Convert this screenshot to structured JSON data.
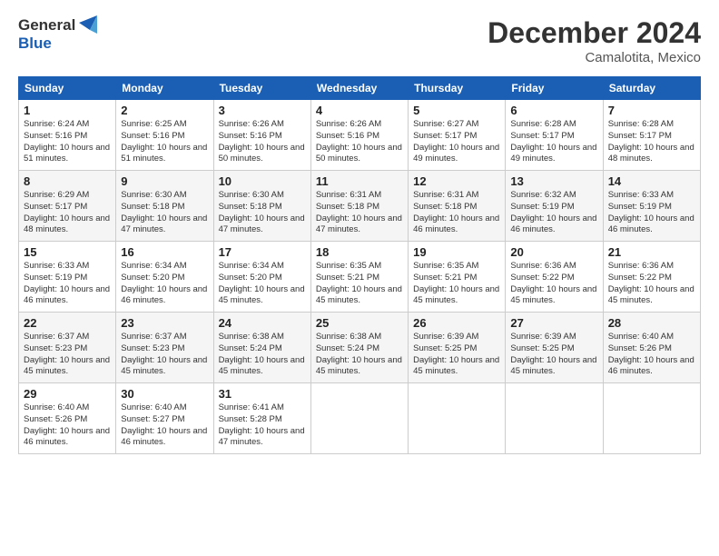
{
  "header": {
    "logo_line1": "General",
    "logo_line2": "Blue",
    "title": "December 2024",
    "subtitle": "Camalotita, Mexico"
  },
  "days_of_week": [
    "Sunday",
    "Monday",
    "Tuesday",
    "Wednesday",
    "Thursday",
    "Friday",
    "Saturday"
  ],
  "weeks": [
    [
      {
        "day": "1",
        "sunrise": "Sunrise: 6:24 AM",
        "sunset": "Sunset: 5:16 PM",
        "daylight": "Daylight: 10 hours and 51 minutes."
      },
      {
        "day": "2",
        "sunrise": "Sunrise: 6:25 AM",
        "sunset": "Sunset: 5:16 PM",
        "daylight": "Daylight: 10 hours and 51 minutes."
      },
      {
        "day": "3",
        "sunrise": "Sunrise: 6:26 AM",
        "sunset": "Sunset: 5:16 PM",
        "daylight": "Daylight: 10 hours and 50 minutes."
      },
      {
        "day": "4",
        "sunrise": "Sunrise: 6:26 AM",
        "sunset": "Sunset: 5:16 PM",
        "daylight": "Daylight: 10 hours and 50 minutes."
      },
      {
        "day": "5",
        "sunrise": "Sunrise: 6:27 AM",
        "sunset": "Sunset: 5:17 PM",
        "daylight": "Daylight: 10 hours and 49 minutes."
      },
      {
        "day": "6",
        "sunrise": "Sunrise: 6:28 AM",
        "sunset": "Sunset: 5:17 PM",
        "daylight": "Daylight: 10 hours and 49 minutes."
      },
      {
        "day": "7",
        "sunrise": "Sunrise: 6:28 AM",
        "sunset": "Sunset: 5:17 PM",
        "daylight": "Daylight: 10 hours and 48 minutes."
      }
    ],
    [
      {
        "day": "8",
        "sunrise": "Sunrise: 6:29 AM",
        "sunset": "Sunset: 5:17 PM",
        "daylight": "Daylight: 10 hours and 48 minutes."
      },
      {
        "day": "9",
        "sunrise": "Sunrise: 6:30 AM",
        "sunset": "Sunset: 5:18 PM",
        "daylight": "Daylight: 10 hours and 47 minutes."
      },
      {
        "day": "10",
        "sunrise": "Sunrise: 6:30 AM",
        "sunset": "Sunset: 5:18 PM",
        "daylight": "Daylight: 10 hours and 47 minutes."
      },
      {
        "day": "11",
        "sunrise": "Sunrise: 6:31 AM",
        "sunset": "Sunset: 5:18 PM",
        "daylight": "Daylight: 10 hours and 47 minutes."
      },
      {
        "day": "12",
        "sunrise": "Sunrise: 6:31 AM",
        "sunset": "Sunset: 5:18 PM",
        "daylight": "Daylight: 10 hours and 46 minutes."
      },
      {
        "day": "13",
        "sunrise": "Sunrise: 6:32 AM",
        "sunset": "Sunset: 5:19 PM",
        "daylight": "Daylight: 10 hours and 46 minutes."
      },
      {
        "day": "14",
        "sunrise": "Sunrise: 6:33 AM",
        "sunset": "Sunset: 5:19 PM",
        "daylight": "Daylight: 10 hours and 46 minutes."
      }
    ],
    [
      {
        "day": "15",
        "sunrise": "Sunrise: 6:33 AM",
        "sunset": "Sunset: 5:19 PM",
        "daylight": "Daylight: 10 hours and 46 minutes."
      },
      {
        "day": "16",
        "sunrise": "Sunrise: 6:34 AM",
        "sunset": "Sunset: 5:20 PM",
        "daylight": "Daylight: 10 hours and 46 minutes."
      },
      {
        "day": "17",
        "sunrise": "Sunrise: 6:34 AM",
        "sunset": "Sunset: 5:20 PM",
        "daylight": "Daylight: 10 hours and 45 minutes."
      },
      {
        "day": "18",
        "sunrise": "Sunrise: 6:35 AM",
        "sunset": "Sunset: 5:21 PM",
        "daylight": "Daylight: 10 hours and 45 minutes."
      },
      {
        "day": "19",
        "sunrise": "Sunrise: 6:35 AM",
        "sunset": "Sunset: 5:21 PM",
        "daylight": "Daylight: 10 hours and 45 minutes."
      },
      {
        "day": "20",
        "sunrise": "Sunrise: 6:36 AM",
        "sunset": "Sunset: 5:22 PM",
        "daylight": "Daylight: 10 hours and 45 minutes."
      },
      {
        "day": "21",
        "sunrise": "Sunrise: 6:36 AM",
        "sunset": "Sunset: 5:22 PM",
        "daylight": "Daylight: 10 hours and 45 minutes."
      }
    ],
    [
      {
        "day": "22",
        "sunrise": "Sunrise: 6:37 AM",
        "sunset": "Sunset: 5:23 PM",
        "daylight": "Daylight: 10 hours and 45 minutes."
      },
      {
        "day": "23",
        "sunrise": "Sunrise: 6:37 AM",
        "sunset": "Sunset: 5:23 PM",
        "daylight": "Daylight: 10 hours and 45 minutes."
      },
      {
        "day": "24",
        "sunrise": "Sunrise: 6:38 AM",
        "sunset": "Sunset: 5:24 PM",
        "daylight": "Daylight: 10 hours and 45 minutes."
      },
      {
        "day": "25",
        "sunrise": "Sunrise: 6:38 AM",
        "sunset": "Sunset: 5:24 PM",
        "daylight": "Daylight: 10 hours and 45 minutes."
      },
      {
        "day": "26",
        "sunrise": "Sunrise: 6:39 AM",
        "sunset": "Sunset: 5:25 PM",
        "daylight": "Daylight: 10 hours and 45 minutes."
      },
      {
        "day": "27",
        "sunrise": "Sunrise: 6:39 AM",
        "sunset": "Sunset: 5:25 PM",
        "daylight": "Daylight: 10 hours and 45 minutes."
      },
      {
        "day": "28",
        "sunrise": "Sunrise: 6:40 AM",
        "sunset": "Sunset: 5:26 PM",
        "daylight": "Daylight: 10 hours and 46 minutes."
      }
    ],
    [
      {
        "day": "29",
        "sunrise": "Sunrise: 6:40 AM",
        "sunset": "Sunset: 5:26 PM",
        "daylight": "Daylight: 10 hours and 46 minutes."
      },
      {
        "day": "30",
        "sunrise": "Sunrise: 6:40 AM",
        "sunset": "Sunset: 5:27 PM",
        "daylight": "Daylight: 10 hours and 46 minutes."
      },
      {
        "day": "31",
        "sunrise": "Sunrise: 6:41 AM",
        "sunset": "Sunset: 5:28 PM",
        "daylight": "Daylight: 10 hours and 47 minutes."
      },
      null,
      null,
      null,
      null
    ]
  ]
}
